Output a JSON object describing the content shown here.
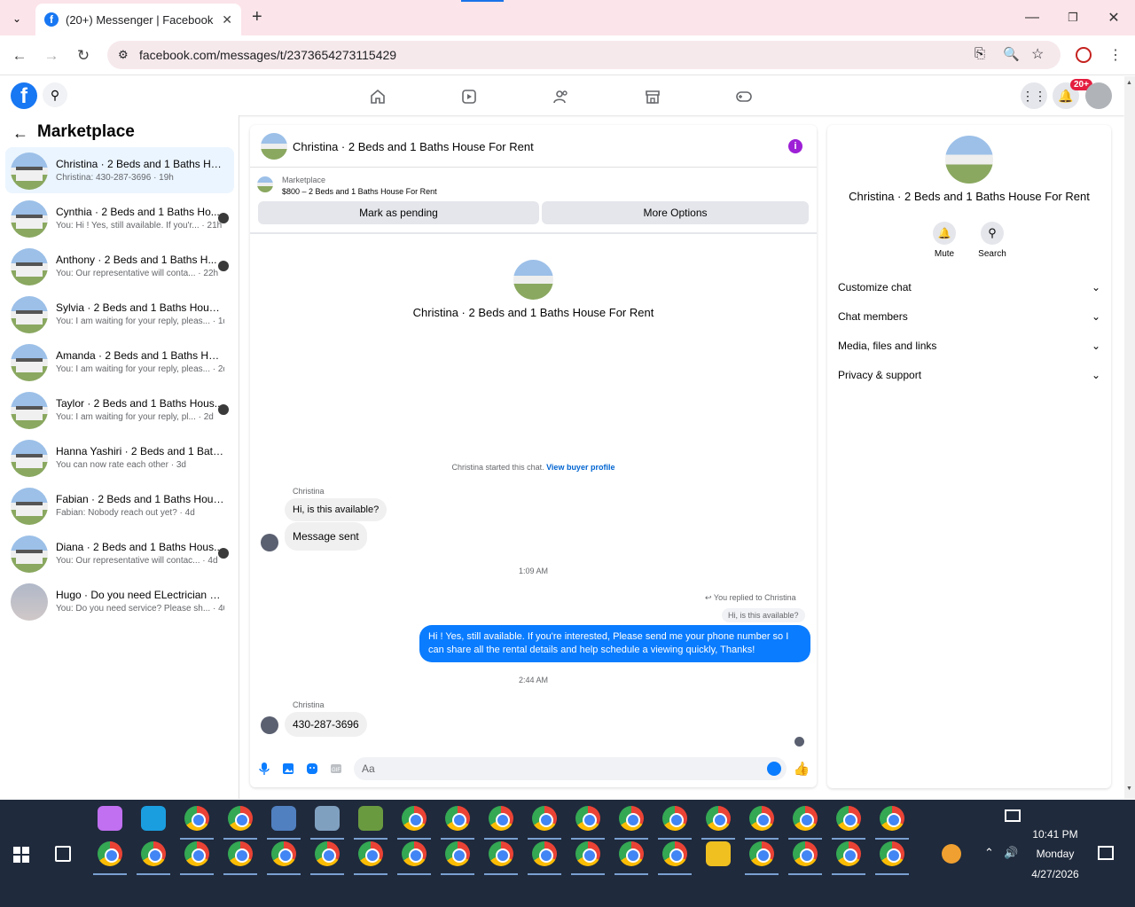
{
  "browser": {
    "tab_title": "(20+) Messenger | Facebook",
    "url": "facebook.com/messages/t/2373654273115429"
  },
  "topbar": {
    "notifications_badge": "20+"
  },
  "sidebar": {
    "title": "Marketplace",
    "conversations": [
      {
        "title": "Christina · 2 Beds and 1 Baths Hou...",
        "sub": "Christina: 430-287-3696 · 19h",
        "selected": true,
        "avatar": "house"
      },
      {
        "title": "Cynthia · 2 Beds and 1 Baths Ho...",
        "sub": "You: Hi ! Yes, still available. If you'r... · 21h",
        "avatar": "house"
      },
      {
        "title": "Anthony · 2 Beds and 1 Baths H...",
        "sub": "You: Our representative will conta... · 22h",
        "avatar": "house"
      },
      {
        "title": "Sylvia · 2 Beds and 1 Baths House ...",
        "sub": "You: I am waiting for your reply, pleas... · 1d",
        "avatar": "house"
      },
      {
        "title": "Amanda · 2 Beds and 1 Baths Hous...",
        "sub": "You: I am waiting for your reply, pleas... · 2d",
        "avatar": "house"
      },
      {
        "title": "Taylor · 2 Beds and 1 Baths Hous...",
        "sub": "You: I am waiting for your reply, pl... · 2d",
        "avatar": "house"
      },
      {
        "title": "Hanna Yashiri · 2 Beds and 1 Baths ...",
        "sub": "You can now rate each other · 3d",
        "avatar": "house"
      },
      {
        "title": "Fabian · 2 Beds and 1 Baths House ...",
        "sub": "Fabian: Nobody reach out yet? · 4d",
        "avatar": "house"
      },
      {
        "title": "Diana · 2 Beds and 1 Baths Hous...",
        "sub": "You: Our representative will contac... · 4d",
        "avatar": "house"
      },
      {
        "title": "Hugo · Do you need ELectrician se...",
        "sub": "You: Do you need service? Please sh... · 40w",
        "avatar": "person"
      }
    ]
  },
  "chat": {
    "header_title": "Christina · 2 Beds and 1 Baths House For Rent",
    "listing_label": "Marketplace",
    "listing_detail": "$800 – 2 Beds and 1 Baths House For Rent",
    "mark_pending": "Mark as pending",
    "more_options": "More Options",
    "intro_title": "Christina · 2 Beds and 1 Baths House For Rent",
    "started_text": "Christina started this chat.",
    "view_profile": "View buyer profile",
    "sender1": "Christina",
    "msg1": "Hi, is this available?",
    "msg2": "Message sent",
    "time1": "1:09 AM",
    "replied_to": "You replied to Christina",
    "quoted": "Hi, is this available?",
    "my_msg": "Hi ! Yes, still available. If you're interested, Please send me your phone number so I can share all the rental details and help schedule a viewing quickly, Thanks!",
    "time2": "2:44 AM",
    "sender2": "Christina",
    "msg3": "430-287-3696",
    "composer_placeholder": "Aa"
  },
  "details": {
    "title": "Christina · 2 Beds and 1 Baths House For Rent",
    "mute": "Mute",
    "search": "Search",
    "sections": [
      "Customize chat",
      "Chat members",
      "Media, files and links",
      "Privacy & support"
    ]
  },
  "taskbar": {
    "time": "10:41 PM",
    "day": "Monday",
    "date": "4/27/2026"
  }
}
